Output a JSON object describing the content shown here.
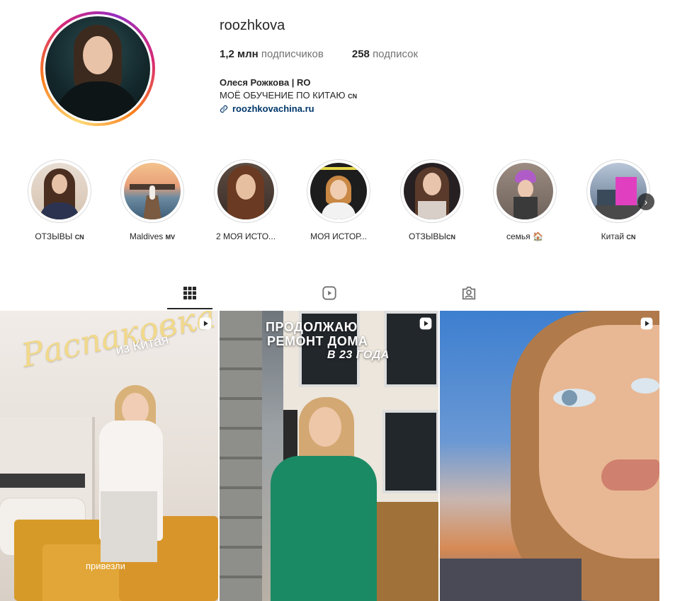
{
  "profile": {
    "username": "roozhkova",
    "followers_count": "1,2 млн",
    "followers_label": "подписчиков",
    "following_count": "258",
    "following_label": "подписок",
    "full_name": "Олеся Рожкова | RO",
    "bio_line": "МОЁ ОБУЧЕНИЕ ПО КИТАЮ",
    "bio_flag": "CN",
    "website": "roozhkovachina.ru"
  },
  "highlights": [
    {
      "label": "ОТЗЫВЫ",
      "flag": "CN",
      "bg": "#6b4a3a",
      "hair": "#4a2e20"
    },
    {
      "label": "Maldives",
      "flag": "MV",
      "bg": "#c98a5a",
      "hair": "#7a5a40"
    },
    {
      "label": "2 МОЯ ИСТО...",
      "flag": "",
      "bg": "#4d4038",
      "hair": "#6a3a22"
    },
    {
      "label": "МОЯ ИСТОР...",
      "flag": "",
      "bg": "#1d1d1d",
      "hair": "#c98844"
    },
    {
      "label": "ОТЗЫВЫ",
      "flag": "CN",
      "bg": "#2a2022",
      "hair": "#5a3a2a"
    },
    {
      "label": "семья",
      "flag": "🏠",
      "bg": "#8a7a70",
      "hair": "#b05cc8"
    },
    {
      "label": "Китай",
      "flag": "CN",
      "bg": "#5a6e88",
      "hair": "#e040c0"
    }
  ],
  "tabs": [
    {
      "name": "posts",
      "icon": "grid-icon",
      "active": true
    },
    {
      "name": "reels",
      "icon": "reels-icon",
      "active": false
    },
    {
      "name": "tagged",
      "icon": "tagged-icon",
      "active": false
    }
  ],
  "posts": [
    {
      "title_script": "Распаковка",
      "subtitle": "из Китая",
      "caption": "привезли",
      "type": "reel"
    },
    {
      "title_line1": "ПРОДОЛЖАЮ",
      "title_line2": "РЕМОНТ ДОМА",
      "title_line3": "В 23 ГОДА",
      "type": "reel"
    },
    {
      "type": "reel"
    }
  ],
  "colors": {
    "link": "#00376b",
    "muted": "#737373",
    "story_ring": "#dbdbdb"
  }
}
